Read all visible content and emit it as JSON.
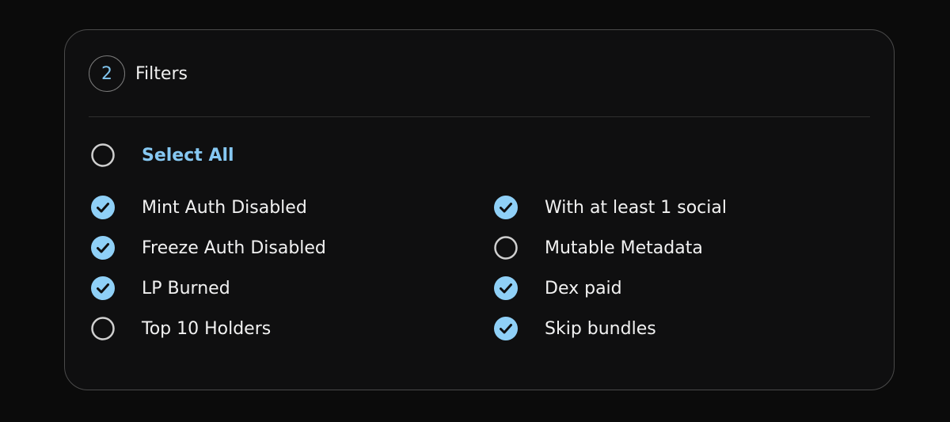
{
  "header": {
    "step_number": "2",
    "title": "Filters"
  },
  "select_all": {
    "label": "Select All",
    "checked": false
  },
  "filters": [
    {
      "label": "Mint Auth Disabled",
      "checked": true
    },
    {
      "label": "Freeze Auth Disabled",
      "checked": true
    },
    {
      "label": "LP Burned",
      "checked": true
    },
    {
      "label": "Top 10 Holders",
      "checked": false
    },
    {
      "label": "With at least 1 social",
      "checked": true
    },
    {
      "label": "Mutable Metadata",
      "checked": false
    },
    {
      "label": "Dex paid",
      "checked": true
    },
    {
      "label": "Skip bundles",
      "checked": true
    }
  ],
  "colors": {
    "accent": "#8fd0f7",
    "check_mark": "#0f0f10",
    "unchecked_ring": "#cfcfcf",
    "background": "#0b0b0b",
    "panel": "#0f0f10"
  }
}
